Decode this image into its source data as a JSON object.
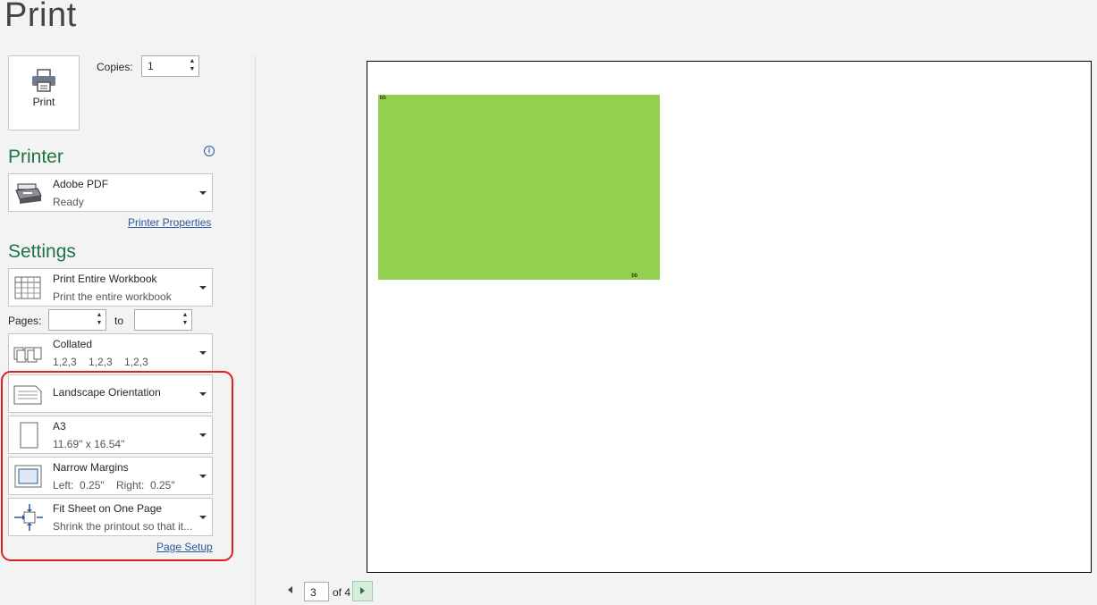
{
  "header": {
    "title": "Print"
  },
  "print_button": {
    "label": "Print",
    "icon": "printer-icon"
  },
  "copies": {
    "label": "Copies:",
    "value": "1"
  },
  "printer": {
    "heading": "Printer",
    "name": "Adobe PDF",
    "status": "Ready",
    "properties_link": "Printer Properties"
  },
  "settings": {
    "heading": "Settings",
    "scope": {
      "title": "Print Entire Workbook",
      "subtitle": "Print the entire workbook"
    },
    "pages": {
      "label": "Pages:",
      "to_label": "to",
      "from_value": "",
      "to_value": ""
    },
    "collation": {
      "title": "Collated",
      "subtitle": "1,2,3    1,2,3    1,2,3"
    },
    "orientation": {
      "title": "Landscape Orientation"
    },
    "paper": {
      "title": "A3",
      "subtitle": "11.69\" x 16.54\""
    },
    "margins": {
      "title": "Narrow Margins",
      "subtitle": "Left:  0.25\"    Right:  0.25\""
    },
    "scaling": {
      "title": "Fit Sheet on One Page",
      "subtitle": "Shrink the printout so that it..."
    },
    "page_setup_link": "Page Setup"
  },
  "preview": {
    "top_left_cell": "bb",
    "bottom_right_cell": "bb",
    "fill_color": "#92d050"
  },
  "navigation": {
    "current_page": "3",
    "of_text": "of 4"
  }
}
